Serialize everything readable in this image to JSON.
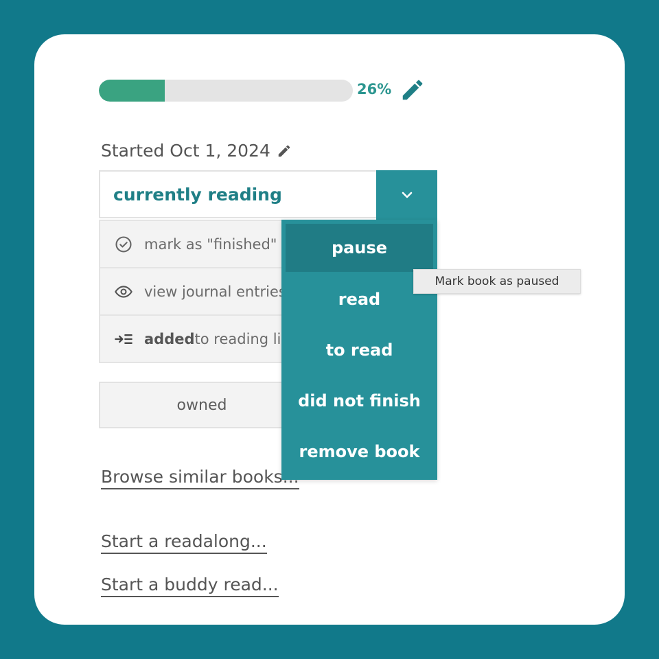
{
  "progress": {
    "percent_label": "26%",
    "value": 0.26
  },
  "started": {
    "label": "Started Oct 1, 2024"
  },
  "status": {
    "current": "currently reading"
  },
  "actions": [
    {
      "label_bold": "",
      "label": "mark as \"finished\"",
      "icon": "check-circle-icon"
    },
    {
      "label_bold": "",
      "label": "view journal entries",
      "icon": "eye-icon"
    },
    {
      "label_bold": "added",
      "label": " to reading list",
      "icon": "add-to-list-icon"
    }
  ],
  "owned_button": {
    "label": "owned"
  },
  "links": {
    "browse_similar": "Browse similar books...",
    "readalong": "Start a readalong...",
    "buddy_read": "Start a buddy read..."
  },
  "dropdown": {
    "options": [
      "pause",
      "read",
      "to read",
      "did not finish",
      "remove book"
    ],
    "highlighted": "pause"
  },
  "tooltip": {
    "text": "Mark book as paused"
  },
  "colors": {
    "background": "#11798a",
    "accent": "#27919a",
    "progress_fill": "#3aa381",
    "progress_text": "#2c9690"
  }
}
